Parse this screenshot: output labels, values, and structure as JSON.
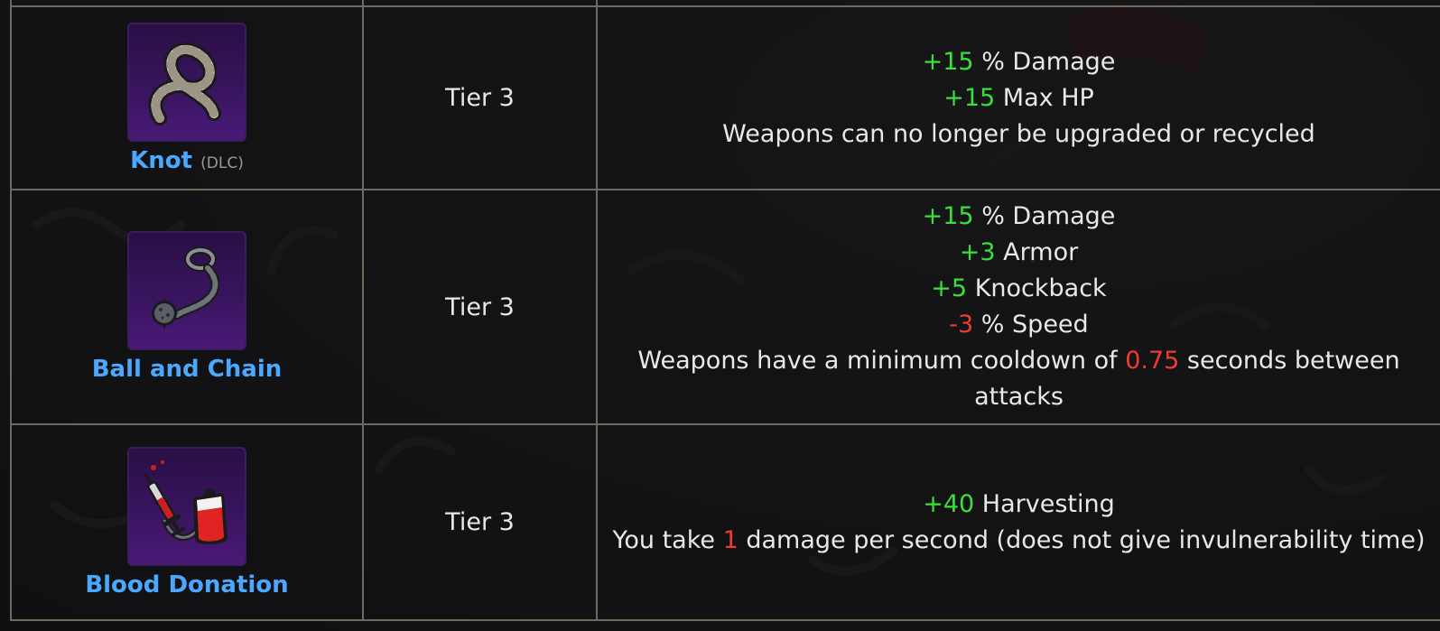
{
  "colors": {
    "item_name": "#4aa8ff",
    "positive": "#38e038",
    "negative": "#ee3b32",
    "border": "#6f6a60",
    "icon_bg": "#3a1560"
  },
  "rows": [
    {
      "name": "Knot",
      "dlc_tag": "(DLC)",
      "icon": "knot-rope-icon",
      "tier": "Tier 3",
      "effects": [
        {
          "value": "+15",
          "text": " % Damage"
        },
        {
          "value": "+15",
          "text": " Max HP"
        },
        {
          "text": "Weapons can no longer be upgraded or recycled"
        }
      ]
    },
    {
      "name": "Ball and Chain",
      "icon": "ball-and-chain-icon",
      "tier": "Tier 3",
      "effects": [
        {
          "value": "+15",
          "text": " % Damage"
        },
        {
          "value": "+3",
          "text": " Armor"
        },
        {
          "value": "+5",
          "text": " Knockback"
        },
        {
          "value": "-3",
          "text": " % Speed"
        },
        {
          "pre": "Weapons have a minimum cooldown of ",
          "value": "0.75",
          "post": " seconds between attacks"
        }
      ]
    },
    {
      "name": "Blood Donation",
      "icon": "blood-donation-icon",
      "tier": "Tier 3",
      "effects": [
        {
          "value": "+40",
          "text": " Harvesting"
        },
        {
          "pre": "You take ",
          "value": "1",
          "post": " damage per second (does not give invulnerability time)"
        }
      ]
    }
  ]
}
